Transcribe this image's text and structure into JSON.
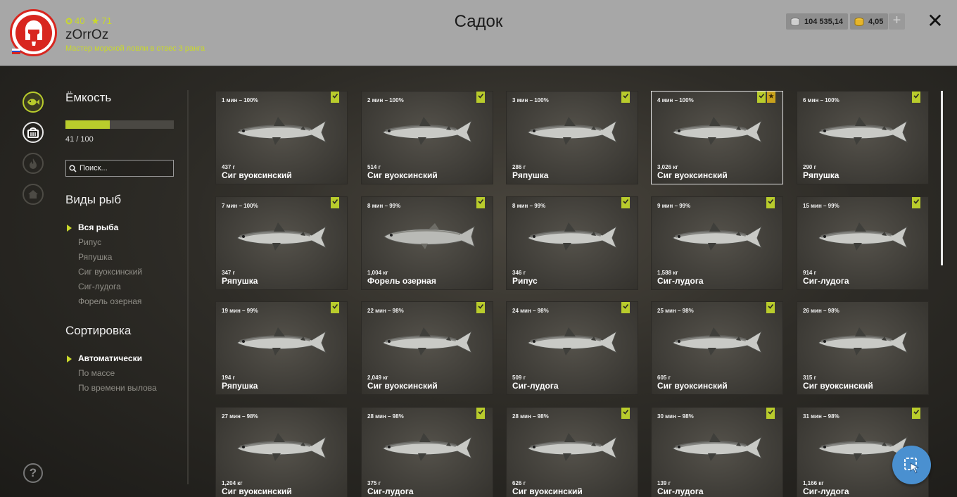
{
  "header": {
    "title": "Садок",
    "player": {
      "coins": "40",
      "stars": "71",
      "username": "zOrrOz",
      "rank": "Мастер морской ловли в отвес 3 ранга"
    },
    "silver": "104 535,14",
    "gold": "4,05",
    "plus_label": "+",
    "close_label": "✕"
  },
  "sidebar": {
    "capacity_title": "Ёмкость",
    "capacity_text": "41 / 100",
    "capacity_fraction": 0.41,
    "search_placeholder": "Поиск...",
    "species_title": "Виды рыб",
    "species": [
      {
        "label": "Вся рыба",
        "active": true
      },
      {
        "label": "Рипус",
        "active": false
      },
      {
        "label": "Ряпушка",
        "active": false
      },
      {
        "label": "Сиг вуоксинский",
        "active": false
      },
      {
        "label": "Сиг-лудога",
        "active": false
      },
      {
        "label": "Форель озерная",
        "active": false
      }
    ],
    "sort_title": "Сортировка",
    "sort": [
      {
        "label": "Автоматически",
        "active": true
      },
      {
        "label": "По массе",
        "active": false
      },
      {
        "label": "По времени вылова",
        "active": false
      }
    ],
    "help_label": "?"
  },
  "colors": {
    "accent": "#b9cc2c",
    "star": "#c9a21c",
    "fab": "#4a90d0"
  },
  "fish": [
    {
      "time": "1 мин – 100%",
      "weight": "437 г",
      "name": "Сиг вуоксинский",
      "marked": true,
      "starred": false,
      "selected": false
    },
    {
      "time": "2 мин – 100%",
      "weight": "514 г",
      "name": "Сиг вуоксинский",
      "marked": true,
      "starred": false,
      "selected": false
    },
    {
      "time": "3 мин – 100%",
      "weight": "286 г",
      "name": "Ряпушка",
      "marked": true,
      "starred": false,
      "selected": false
    },
    {
      "time": "4 мин – 100%",
      "weight": "3,026 кг",
      "name": "Сиг вуоксинский",
      "marked": true,
      "starred": true,
      "selected": true
    },
    {
      "time": "6 мин – 100%",
      "weight": "290 г",
      "name": "Ряпушка",
      "marked": true,
      "starred": false,
      "selected": false
    },
    {
      "time": "7 мин – 100%",
      "weight": "347 г",
      "name": "Ряпушка",
      "marked": true,
      "starred": false,
      "selected": false
    },
    {
      "time": "8 мин – 99%",
      "weight": "1,004 кг",
      "name": "Форель озерная",
      "marked": true,
      "starred": false,
      "selected": false
    },
    {
      "time": "8 мин – 99%",
      "weight": "346 г",
      "name": "Рипус",
      "marked": true,
      "starred": false,
      "selected": false
    },
    {
      "time": "9 мин – 99%",
      "weight": "1,588 кг",
      "name": "Сиг-лудога",
      "marked": true,
      "starred": false,
      "selected": false
    },
    {
      "time": "15 мин – 99%",
      "weight": "914 г",
      "name": "Сиг-лудога",
      "marked": true,
      "starred": false,
      "selected": false
    },
    {
      "time": "19 мин – 99%",
      "weight": "194 г",
      "name": "Ряпушка",
      "marked": true,
      "starred": false,
      "selected": false
    },
    {
      "time": "22 мин – 98%",
      "weight": "2,049 кг",
      "name": "Сиг вуоксинский",
      "marked": true,
      "starred": false,
      "selected": false
    },
    {
      "time": "24 мин – 98%",
      "weight": "509 г",
      "name": "Сиг-лудога",
      "marked": true,
      "starred": false,
      "selected": false
    },
    {
      "time": "25 мин – 98%",
      "weight": "605 г",
      "name": "Сиг вуоксинский",
      "marked": true,
      "starred": false,
      "selected": false
    },
    {
      "time": "26 мин – 98%",
      "weight": "315 г",
      "name": "Сиг вуоксинский",
      "marked": false,
      "starred": false,
      "selected": false
    },
    {
      "time": "27 мин – 98%",
      "weight": "1,204 кг",
      "name": "Сиг вуоксинский",
      "marked": false,
      "starred": false,
      "selected": false
    },
    {
      "time": "28 мин – 98%",
      "weight": "375 г",
      "name": "Сиг-лудога",
      "marked": true,
      "starred": false,
      "selected": false
    },
    {
      "time": "28 мин – 98%",
      "weight": "626 г",
      "name": "Сиг вуоксинский",
      "marked": true,
      "starred": false,
      "selected": false
    },
    {
      "time": "30 мин – 98%",
      "weight": "139 г",
      "name": "Сиг-лудога",
      "marked": true,
      "starred": false,
      "selected": false
    },
    {
      "time": "31 мин – 98%",
      "weight": "1,166 кг",
      "name": "Сиг-лудога",
      "marked": true,
      "starred": false,
      "selected": false
    }
  ],
  "scroll_fraction": 0.44
}
